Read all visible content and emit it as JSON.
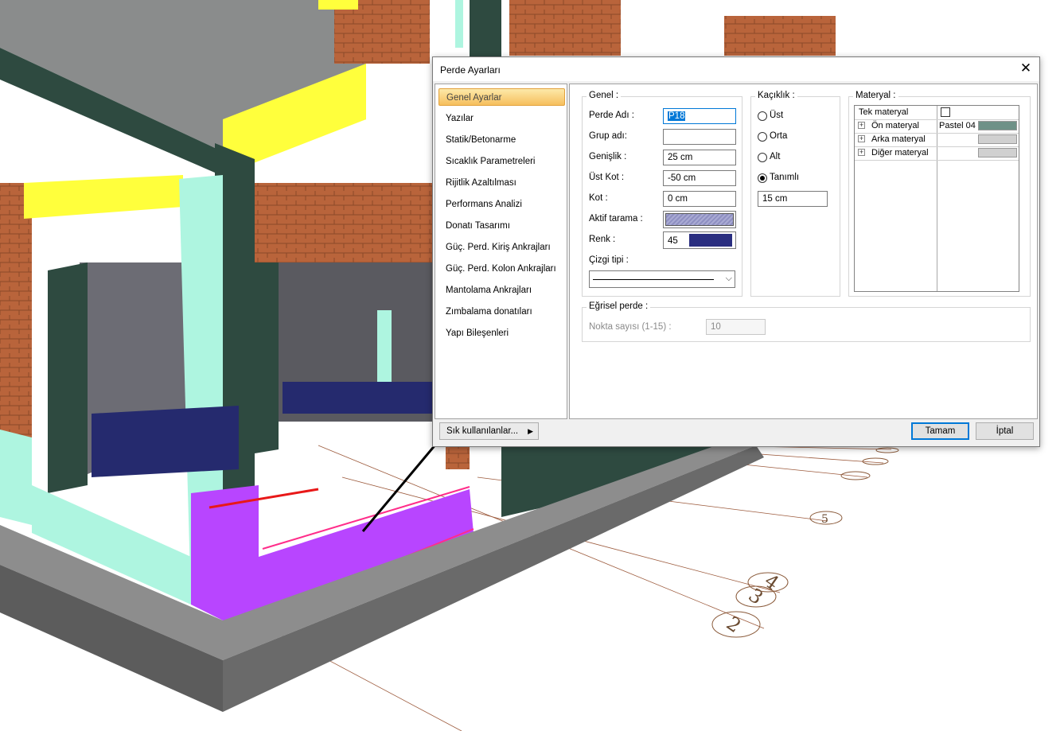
{
  "dialog": {
    "title": "Perde Ayarları",
    "close_icon": "close-icon",
    "sidebar": [
      {
        "label": "Genel Ayarlar",
        "active": true
      },
      {
        "label": "Yazılar"
      },
      {
        "label": "Statik/Betonarme"
      },
      {
        "label": "Sıcaklık Parametreleri"
      },
      {
        "label": "Rijitlik Azaltılması"
      },
      {
        "label": "Performans Analizi"
      },
      {
        "label": "Donatı Tasarımı"
      },
      {
        "label": "Güç. Perd. Kiriş Ankrajları"
      },
      {
        "label": "Güç. Perd. Kolon Ankrajları"
      },
      {
        "label": "Mantolama Ankrajları"
      },
      {
        "label": "Zımbalama donatıları"
      },
      {
        "label": "Yapı Bileşenleri"
      }
    ],
    "genel": {
      "title": "Genel :",
      "perde_adi_label": "Perde Adı :",
      "perde_adi_value": "P18",
      "grup_adi_label": "Grup adı:",
      "grup_adi_value": "",
      "genislik_label": "Genişlik :",
      "genislik_value": "25 cm",
      "ust_kot_label": "Üst Kot :",
      "ust_kot_value": "-50 cm",
      "kot_label": "Kot :",
      "kot_value": "0 cm",
      "aktif_tarama_label": "Aktif tarama :",
      "renk_label": "Renk :",
      "renk_value": "45",
      "renk_color": "#2a2e80",
      "cizgi_tipi_label": "Çizgi tipi :"
    },
    "kacikik": {
      "title": "Kaçıklık :",
      "options": [
        "Üst",
        "Orta",
        "Alt",
        "Tanımlı"
      ],
      "selected": "Tanımlı",
      "value": "15 cm"
    },
    "materyal": {
      "title": "Materyal :",
      "tek_materyal_label": "Tek materyal",
      "rows": [
        {
          "label": "Ön materyal",
          "value": "Pastel 04",
          "color": "#6e9187"
        },
        {
          "label": "Arka materyal",
          "value": "",
          "color": "#d0d0d0"
        },
        {
          "label": "Diğer materyal",
          "value": "",
          "color": "#d0d0d0"
        }
      ]
    },
    "egrisel": {
      "title": "Eğrisel perde :",
      "nokta_label": "Nokta sayısı (1-15) :",
      "nokta_value": "10"
    },
    "buttons": {
      "sik": "Sık kullanılanlar...",
      "ok": "Tamam",
      "cancel": "İptal"
    }
  },
  "scene": {
    "axis_labels": [
      "2",
      "3",
      "4",
      "5"
    ]
  }
}
